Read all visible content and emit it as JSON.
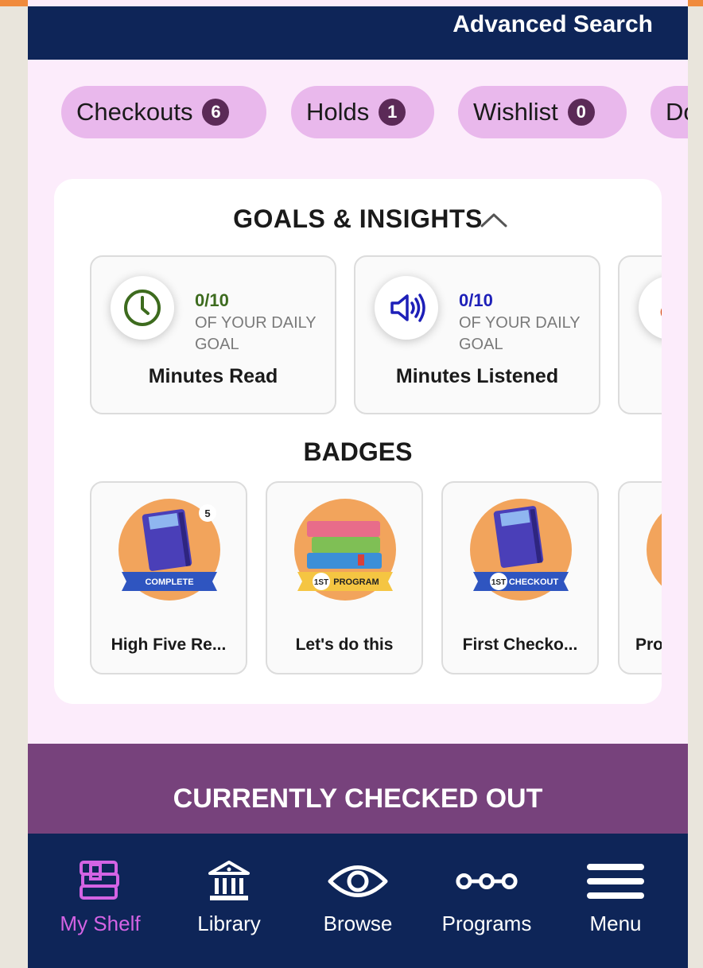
{
  "header": {
    "advanced_search": "Advanced Search"
  },
  "tabs": [
    {
      "label": "Checkouts",
      "count": "6"
    },
    {
      "label": "Holds",
      "count": "1"
    },
    {
      "label": "Wishlist",
      "count": "0"
    },
    {
      "label": "Do"
    }
  ],
  "goals": {
    "title": "GOALS & INSIGHTS",
    "items": [
      {
        "progress": "0/10",
        "sub": "OF YOUR DAILY GOAL",
        "label": "Minutes Read",
        "icon": "clock-icon",
        "color": "#3d6b1e"
      },
      {
        "progress": "0/10",
        "sub": "OF YOUR DAILY GOAL",
        "label": "Minutes Listened",
        "icon": "speaker-icon",
        "color": "#1d1fb8"
      },
      {
        "icon": "flame-icon",
        "color": "#d7501a"
      }
    ]
  },
  "badges": {
    "title": "BADGES",
    "items": [
      {
        "name": "High Five Re...",
        "ribbon": "COMPLETE",
        "corner_number": "5"
      },
      {
        "name": "Let's do this",
        "ribbon": "PROGRAM",
        "ribbon_num": "1ST"
      },
      {
        "name": "First Checko...",
        "ribbon": "CHECKOUT",
        "ribbon_num": "1ST"
      },
      {
        "name": "Pro"
      }
    ]
  },
  "section": {
    "checked_out_title": "CURRENTLY CHECKED OUT"
  },
  "nav": [
    {
      "label": "My Shelf",
      "active": true
    },
    {
      "label": "Library"
    },
    {
      "label": "Browse"
    },
    {
      "label": "Programs"
    },
    {
      "label": "Menu"
    }
  ],
  "colors": {
    "header": "#0e2558",
    "pill": "#e9b8ec",
    "pill_badge": "#5b2a57",
    "section_bar": "#77427c",
    "active_nav": "#d463e4"
  }
}
